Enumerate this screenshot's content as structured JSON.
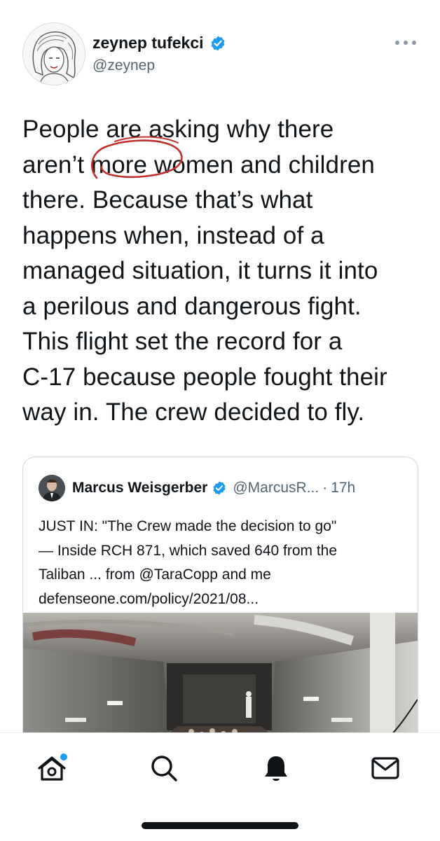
{
  "tweet": {
    "author_name": "zeynep tufekci",
    "author_handle": "@zeynep",
    "lines": [
      "People are asking why there",
      "aren’t more women and children",
      "there. Because that’s what",
      "happens when, instead of a",
      "managed situation, it turns it into",
      "a perilous  and dangerous fight.",
      "This flight set the record for a",
      "C-17 because people fought their",
      "way in. The crew decided to fly."
    ]
  },
  "quote": {
    "author_name": "Marcus Weisgerber",
    "author_handle": "@MarcusR...",
    "separator": "·",
    "time": "17h",
    "lines": [
      "JUST IN: \"The Crew made the decision to go\"",
      "— Inside RCH 871, which saved 640 from the",
      "Taliban ... from @TaraCopp and me",
      "defenseone.com/policy/2021/08..."
    ]
  },
  "tabs": [
    "home-icon",
    "search-icon",
    "notifications-icon",
    "messages-icon"
  ],
  "colors": {
    "verified": "#1d9bf0",
    "text": "#0f1419",
    "secondary": "#536471",
    "notification_dot": "#1d9bf0",
    "annotation": "#c0302b"
  }
}
